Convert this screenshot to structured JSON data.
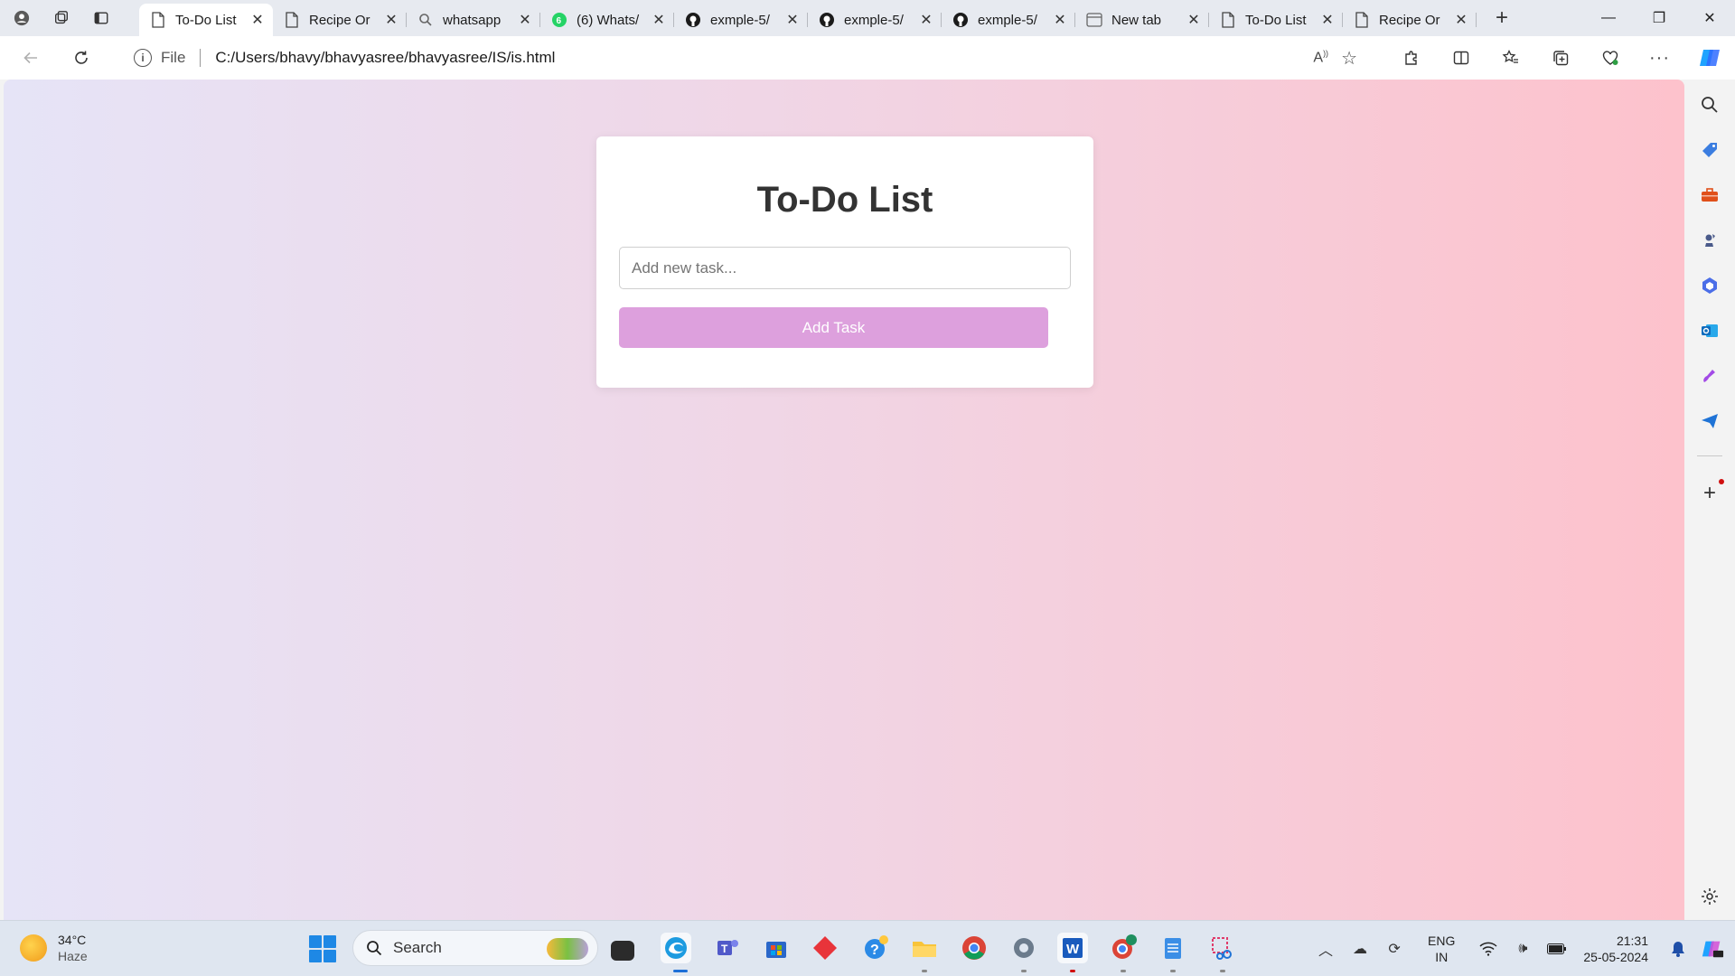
{
  "browser": {
    "tabs": [
      {
        "title": "To-Do List",
        "icon": "page-icon",
        "active": true
      },
      {
        "title": "Recipe Or",
        "icon": "page-icon",
        "active": false
      },
      {
        "title": "whatsapp",
        "icon": "search-icon",
        "active": false
      },
      {
        "title": "(6) Whats/",
        "icon": "whatsapp-icon",
        "active": false
      },
      {
        "title": "exmple-5/",
        "icon": "github-icon",
        "active": false
      },
      {
        "title": "exmple-5/",
        "icon": "github-icon",
        "active": false
      },
      {
        "title": "exmple-5/",
        "icon": "github-icon",
        "active": false
      },
      {
        "title": "New tab",
        "icon": "newtab-icon",
        "active": false
      },
      {
        "title": "To-Do List",
        "icon": "page-icon",
        "active": false
      },
      {
        "title": "Recipe Or",
        "icon": "page-icon",
        "active": false
      }
    ],
    "address": {
      "scheme_label": "File",
      "url": "C:/Users/bhavy/bhavyasree/bhavyasree/IS/is.html"
    }
  },
  "page": {
    "heading": "To-Do List",
    "task_input_placeholder": "Add new task...",
    "add_button_label": "Add Task",
    "colors": {
      "button": "#dda0dd",
      "gradient_start": "#e6e4f7",
      "gradient_end": "#fdc2cc"
    }
  },
  "taskbar": {
    "weather": {
      "temp": "34°C",
      "condition": "Haze"
    },
    "search_label": "Search",
    "language": {
      "line1": "ENG",
      "line2": "IN"
    },
    "clock": {
      "time": "21:31",
      "date": "25-05-2024"
    }
  }
}
